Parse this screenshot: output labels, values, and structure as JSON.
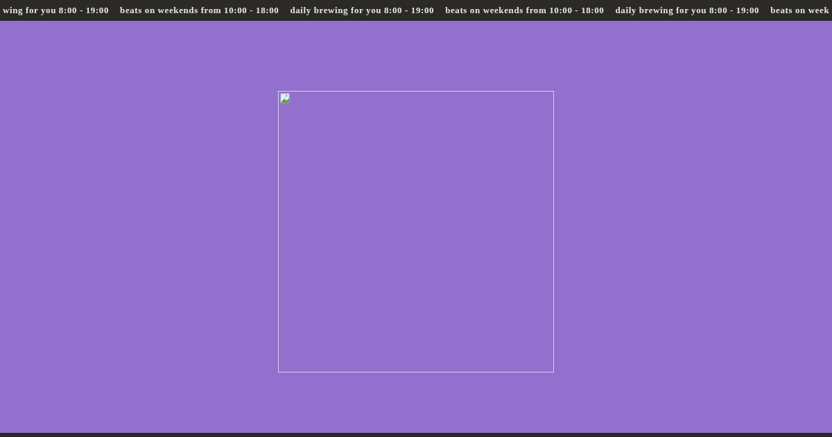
{
  "ticker": [
    "wing for you 8:00 - 19:00",
    "beats on weekends from 10:00 - 18:00",
    "daily brewing for you 8:00 - 19:00",
    "beats on weekends from 10:00 - 18:00",
    "daily brewing for you 8:00 - 19:00",
    "beats on week"
  ],
  "main_image": {
    "kind": "picture",
    "broken": true
  }
}
